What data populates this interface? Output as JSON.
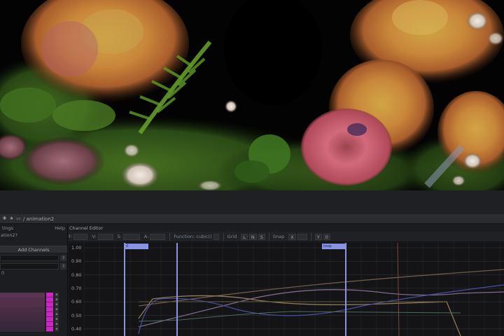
{
  "window": {
    "title": "/ animation2"
  },
  "left_panel": {
    "menu_left": "tings",
    "menu_right": "Help",
    "name": "ation2?",
    "add_channels": "Add Channels",
    "zero_value": "0"
  },
  "channel_editor": {
    "title": "Channel Editor",
    "toolbar": {
      "f_label": "F:",
      "v_label": "V:",
      "s_label": "S:",
      "a_label": "A:",
      "function_label": "Function: cubic()",
      "grid_label": "Grid",
      "grid_l": "L",
      "grid_n": "N",
      "grid_s": "S",
      "snap_label": "Snap",
      "snap_x": "X",
      "snap_y": "Y",
      "snap_0": "0"
    },
    "y_ticks": [
      "1.00",
      "0.90",
      "0.80",
      "0.70",
      "0.60",
      "0.50",
      "0.40"
    ],
    "markers": [
      {
        "label": "0"
      },
      {
        "label": "loop"
      }
    ]
  },
  "colors": {
    "accent_blue": "#8a92e6",
    "channel_magenta": "#c928c3",
    "graph_bg": "#141416",
    "panel_bg": "#1b1c1f"
  },
  "icons": [
    "gear-icon",
    "star-icon",
    "pane-icon"
  ]
}
